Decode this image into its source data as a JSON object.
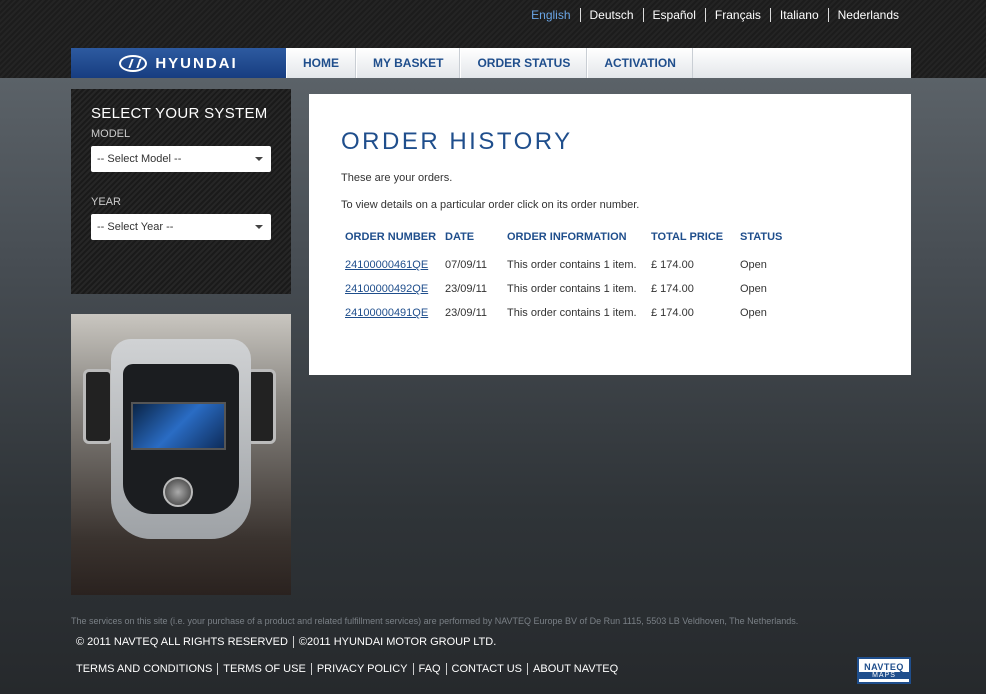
{
  "languages": [
    "English",
    "Deutsch",
    "Español",
    "Français",
    "Italiano",
    "Nederlands"
  ],
  "active_language": "English",
  "brand": {
    "name": "HYUNDAI"
  },
  "nav": [
    "HOME",
    "MY BASKET",
    "ORDER STATUS",
    "ACTIVATION"
  ],
  "sidebar": {
    "title": "SELECT YOUR SYSTEM",
    "model_label": "MODEL",
    "model_value": "-- Select Model --",
    "year_label": "YEAR",
    "year_value": "-- Select Year --"
  },
  "main": {
    "title": "ORDER HISTORY",
    "intro": "These are your orders.",
    "instruction": "To view details on a particular order click on its order number.",
    "columns": [
      "ORDER NUMBER",
      "DATE",
      "ORDER INFORMATION",
      "TOTAL PRICE",
      "STATUS"
    ],
    "orders": [
      {
        "number": "24100000461QE",
        "date": "07/09/11",
        "info": "This order contains 1 item.",
        "price": "£ 174.00",
        "status": "Open"
      },
      {
        "number": "24100000492QE",
        "date": "23/09/11",
        "info": "This order contains 1 item.",
        "price": "£ 174.00",
        "status": "Open"
      },
      {
        "number": "24100000491QE",
        "date": "23/09/11",
        "info": "This order contains 1 item.",
        "price": "£ 174.00",
        "status": "Open"
      }
    ]
  },
  "footer": {
    "note": "The services on this site (i.e. your purchase of a product and related fulfillment services) are performed by NAVTEQ Europe BV of De Run 1115, 5503 LB Veldhoven, The Netherlands.",
    "copyrights": [
      "© 2011 NAVTEQ ALL RIGHTS RESERVED",
      "©2011 HYUNDAI MOTOR GROUP LTD."
    ],
    "links": [
      "TERMS AND CONDITIONS",
      "TERMS OF USE",
      "PRIVACY POLICY",
      "FAQ",
      "CONTACT US",
      "ABOUT NAVTEQ"
    ],
    "navteq_logo": {
      "top": "NAVTEQ",
      "bottom": "MAPS"
    }
  }
}
